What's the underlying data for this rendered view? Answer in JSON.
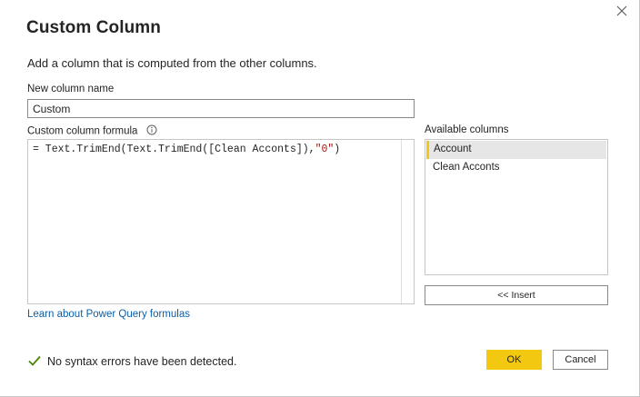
{
  "dialog": {
    "title": "Custom Column",
    "subtitle": "Add a column that is computed from the other columns."
  },
  "name_field": {
    "label": "New column name",
    "value": "Custom"
  },
  "formula": {
    "label": "Custom column formula",
    "prefix": "= Text.TrimEnd(Text.TrimEnd([Clean Acconts]),",
    "string_literal": "\"0\"",
    "suffix": ")"
  },
  "learn_link": "Learn about Power Query formulas",
  "available_columns": {
    "label": "Available columns",
    "items": [
      "Account",
      "Clean Acconts"
    ],
    "selected": "Account"
  },
  "insert_label": "<< Insert",
  "status": {
    "text": "No syntax errors have been detected.",
    "color": "#498205"
  },
  "buttons": {
    "ok": "OK",
    "cancel": "Cancel"
  },
  "colors": {
    "accent": "#f2c811",
    "link": "#0a5fa8"
  }
}
